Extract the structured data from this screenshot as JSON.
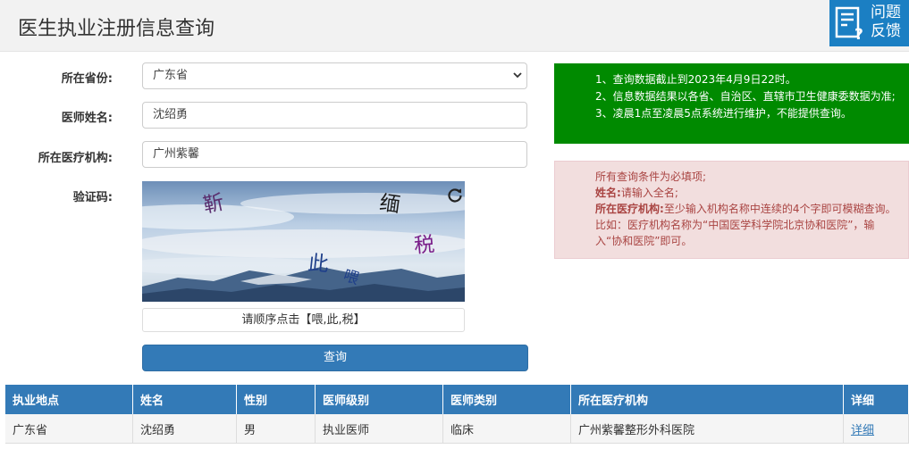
{
  "header": {
    "title": "医生执业注册信息查询"
  },
  "feedback": {
    "label": "问题反馈"
  },
  "form": {
    "province": {
      "label": "所在省份:",
      "value": "广东省"
    },
    "name": {
      "label": "医师姓名:",
      "value": "沈绍勇"
    },
    "institution": {
      "label": "所在医疗机构:",
      "value": "广州紫馨"
    },
    "captcha": {
      "label": "验证码:",
      "chars": [
        "靳",
        "缅",
        "税",
        "此",
        "喂"
      ],
      "hint": "请顺序点击【喂,此,税】"
    },
    "submit_label": "查询"
  },
  "notice_green": {
    "lines": [
      "1、查询数据截止到2023年4月9日22时。",
      "2、信息数据结果以各省、自治区、直辖市卫生健康委数据为准;",
      "3、凌晨1点至凌晨5点系统进行维护，不能提供查询。"
    ]
  },
  "notice_red": {
    "line1": "所有查询条件为必填项;",
    "name_bold": "姓名:",
    "name_text": "请输入全名;",
    "inst_bold": "所在医疗机构:",
    "inst_text": "至少输入机构名称中连续的4个字即可模糊查询。比如：医疗机构名称为“中国医学科学院北京协和医院”，输入“协和医院”即可。"
  },
  "table": {
    "headers": [
      "执业地点",
      "姓名",
      "性别",
      "医师级别",
      "医师类别",
      "所在医疗机构",
      "详细"
    ],
    "rows": [
      [
        "广东省",
        "沈绍勇",
        "男",
        "执业医师",
        "临床",
        "广州紫馨整形外科医院",
        "详细"
      ]
    ]
  },
  "colors": {
    "primary": "#337ab7",
    "notice_green": "#008a00",
    "notice_red_bg": "#f2dede",
    "notice_red_text": "#a94442",
    "feedback_bg": "#1b7fc3"
  }
}
